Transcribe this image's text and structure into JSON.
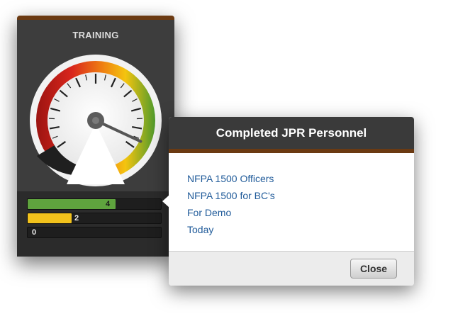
{
  "widget": {
    "title": "TRAINING",
    "gauge": {
      "value": 0.96
    },
    "bars": [
      {
        "value": "4",
        "fill": 0.66,
        "color": "#5fa33e"
      },
      {
        "value": "2",
        "fill": 0.33,
        "color": "#f2c21c"
      },
      {
        "value": "0",
        "fill": 0.0,
        "color": "#444444"
      }
    ]
  },
  "popup": {
    "title": "Completed JPR Personnel",
    "items": [
      "NFPA 1500 Officers",
      "NFPA 1500 for BC's",
      "For Demo",
      "Today"
    ],
    "close_label": "Close"
  },
  "colors": {
    "accent_brown": "#6b3a12",
    "link_blue": "#1f5a99"
  }
}
